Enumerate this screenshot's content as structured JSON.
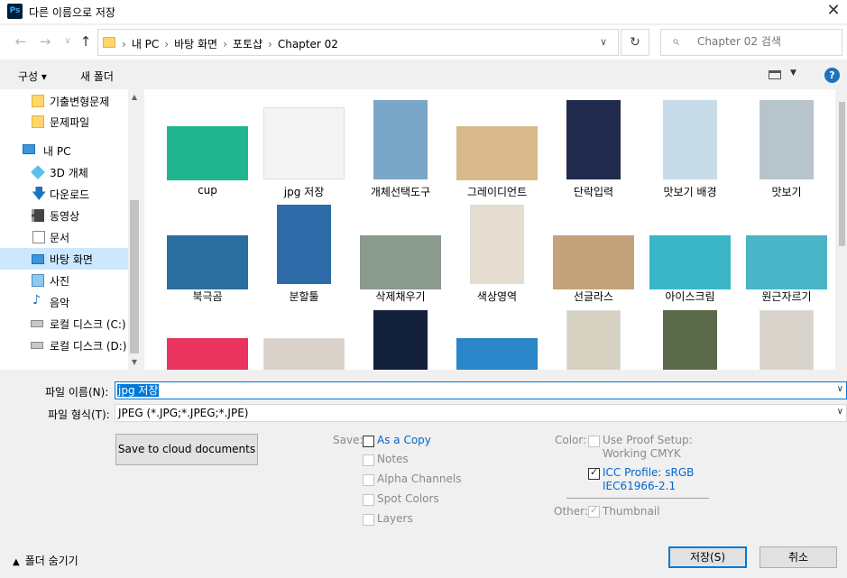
{
  "window": {
    "app_icon": "Ps",
    "title": "다른 이름으로 저장",
    "close_icon": "✕"
  },
  "address": {
    "back_icon": "←",
    "forward_icon": "→",
    "dropdown_icon": "∨",
    "up_icon": "↑",
    "crumbs": [
      "내 PC",
      "바탕 화면",
      "포토샵",
      "Chapter 02"
    ],
    "refresh_icon": "↻",
    "search_placeholder": "Chapter 02 검색",
    "search_icon": "⌕"
  },
  "toolbar": {
    "organize": "구성 ▾",
    "new_folder": "새 폴더",
    "help": "?"
  },
  "sidebar": {
    "items": [
      {
        "label": "기출변형문제",
        "icon": "folder-icon"
      },
      {
        "label": "문제파일",
        "icon": "folder-icon"
      },
      {
        "label": "내 PC",
        "icon": "pc-icon"
      },
      {
        "label": "3D 개체",
        "icon": "cube-icon"
      },
      {
        "label": "다운로드",
        "icon": "download-icon"
      },
      {
        "label": "동영상",
        "icon": "video-icon"
      },
      {
        "label": "문서",
        "icon": "document-icon"
      },
      {
        "label": "바탕 화면",
        "icon": "desktop-icon"
      },
      {
        "label": "사진",
        "icon": "picture-icon"
      },
      {
        "label": "음악",
        "icon": "music-icon"
      },
      {
        "label": "로컬 디스크 (C:)",
        "icon": "drive-icon"
      },
      {
        "label": "로컬 디스크 (D:)",
        "icon": "drive-icon"
      }
    ],
    "scroll_up": "▲",
    "scroll_down": "▼"
  },
  "files": [
    {
      "name": "cup",
      "color": "#1fb58f"
    },
    {
      "name": "jpg 저장",
      "color": "#f4f4f4"
    },
    {
      "name": "개체선택도구",
      "color": "#7aa6c8"
    },
    {
      "name": "그레이디언트",
      "color": "#d8b98b"
    },
    {
      "name": "단락입력",
      "color": "#1f2a4d"
    },
    {
      "name": "맛보기 배경",
      "color": "#c8dbe8"
    },
    {
      "name": "맛보기",
      "color": "#b8c4cc"
    },
    {
      "name": "북극곰",
      "color": "#2b6fa0"
    },
    {
      "name": "분할툴",
      "color": "#2d6ca8"
    },
    {
      "name": "삭제채우기",
      "color": "#8a9a8c"
    },
    {
      "name": "색상영역",
      "color": "#e4ddd0"
    },
    {
      "name": "선글라스",
      "color": "#c4a27a"
    },
    {
      "name": "아이스크림",
      "color": "#3ab6c6"
    },
    {
      "name": "원근자르기",
      "color": "#4ab5c6"
    },
    {
      "name": "",
      "color": "#e8345e"
    },
    {
      "name": "",
      "color": "#d8d2c8"
    },
    {
      "name": "",
      "color": "#12203a"
    },
    {
      "name": "",
      "color": "#2a86c8"
    },
    {
      "name": "",
      "color": "#d6d0c0"
    },
    {
      "name": "",
      "color": "#5a6a4a"
    },
    {
      "name": "",
      "color": "#d8d4cc"
    }
  ],
  "form": {
    "file_name_label": "파일 이름(N):",
    "file_name_value": "jpg 저장",
    "file_type_label": "파일 형식(T):",
    "file_type_value": "JPEG (*.JPG;*.JPEG;*.JPE)",
    "dropdown_icon": "∨",
    "cloud_button": "Save to cloud documents",
    "save_label": "Save:",
    "as_a_copy": "As a Copy",
    "notes": "Notes",
    "alpha_channels": "Alpha Channels",
    "spot_colors": "Spot Colors",
    "layers": "Layers",
    "color_label": "Color:",
    "use_proof_setup_1": "Use Proof Setup:",
    "use_proof_setup_2": "Working CMYK",
    "icc_profile_1": "ICC Profile:  sRGB",
    "icc_profile_2": "IEC61966-2.1",
    "other_label": "Other:",
    "thumbnail": "Thumbnail",
    "hide_folders_icon": "▲",
    "hide_folders": "폴더 숨기기",
    "save_button": "저장(S)",
    "cancel_button": "취소"
  },
  "colors": {
    "accent": "#0078d7",
    "selection": "#cce8ff",
    "link_blue": "#0066cc"
  }
}
